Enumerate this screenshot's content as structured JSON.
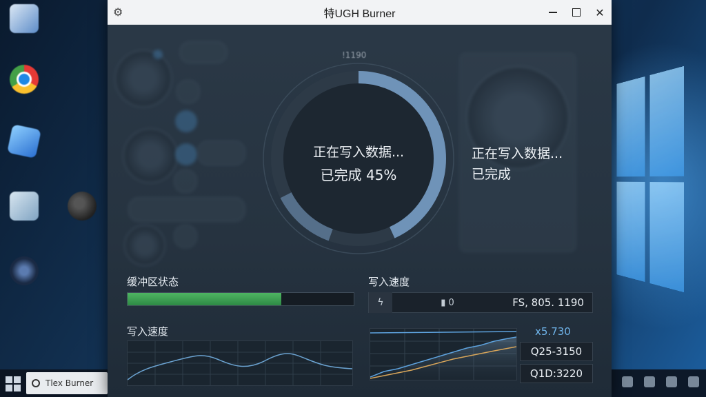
{
  "window": {
    "title": "特UGH Burner",
    "app_icon": "gear-icon"
  },
  "taskbar": {
    "search_text": "Tlex Burner"
  },
  "progress": {
    "top_label": "!1190",
    "status_line": "正在写入数据...",
    "percent_line": "已完成 45%",
    "percent": 45,
    "ring_color": "#6f93b8"
  },
  "side_status": {
    "line1": "正在写入数据...",
    "line2": "已完成"
  },
  "buffer": {
    "label": "缓冲区状态",
    "fill_fraction": 0.68,
    "color": "#3fa257"
  },
  "speed": {
    "label": "写入速度",
    "mid_text": "▮ 0",
    "value": "FS, 805. 1190",
    "icon": "lightning-icon"
  },
  "speed_chart": {
    "label": "写入速度"
  },
  "stats": {
    "accent_value": "x5.730",
    "box1": "Q25-3150",
    "box2": "Q1D:3220"
  }
}
